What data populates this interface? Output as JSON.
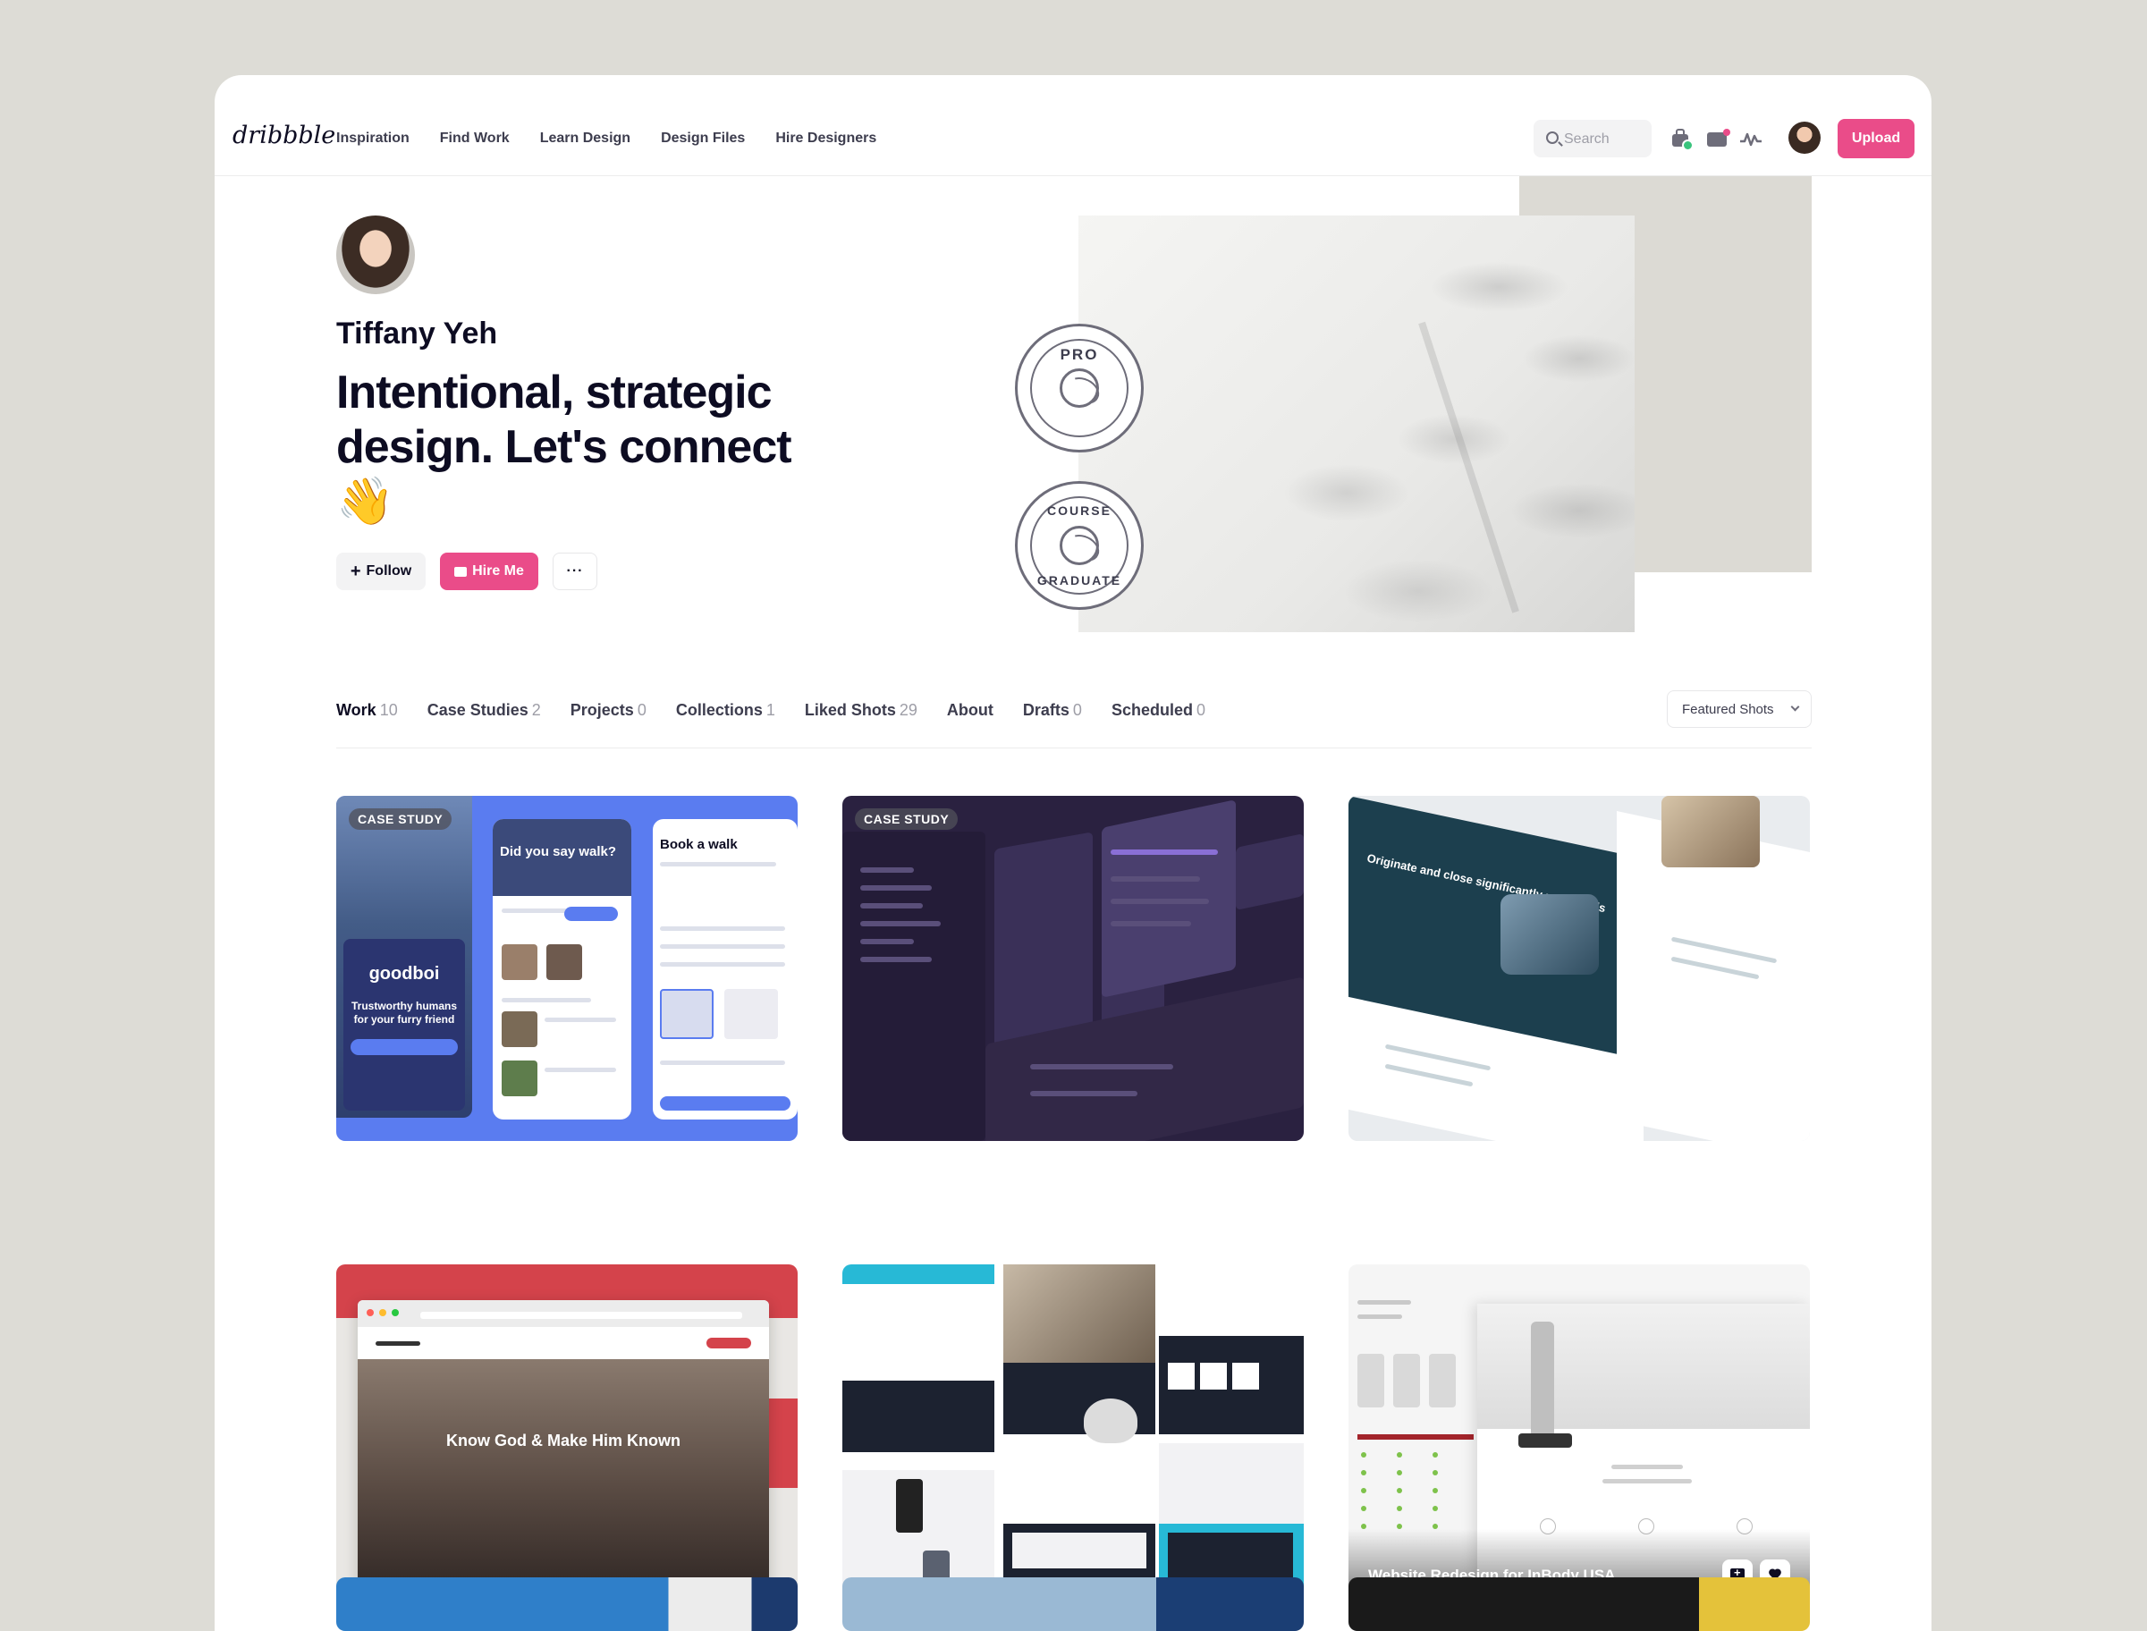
{
  "nav": {
    "logo": "dribbble",
    "links": [
      "Inspiration",
      "Find Work",
      "Learn Design",
      "Design Files",
      "Hire Designers"
    ],
    "search_placeholder": "Search",
    "upload_label": "Upload",
    "icons": [
      "search-icon",
      "briefcase-icon",
      "mail-icon",
      "activity-icon",
      "avatar"
    ]
  },
  "profile": {
    "name": "Tiffany Yeh",
    "headline": "Intentional, strategic design. Let's connect 👋",
    "follow_label": "Follow",
    "hire_label": "Hire Me",
    "more_label": "···",
    "badges": [
      {
        "top": "PRO"
      },
      {
        "top": "COURSE",
        "bottom": "GRADUATE"
      }
    ]
  },
  "tabs": [
    {
      "label": "Work",
      "count": "10"
    },
    {
      "label": "Case Studies",
      "count": "2"
    },
    {
      "label": "Projects",
      "count": "0"
    },
    {
      "label": "Collections",
      "count": "1"
    },
    {
      "label": "Liked Shots",
      "count": "29"
    },
    {
      "label": "About",
      "count": ""
    },
    {
      "label": "Drafts",
      "count": "0"
    },
    {
      "label": "Scheduled",
      "count": "0"
    }
  ],
  "sort": {
    "selected": "Featured Shots"
  },
  "shots": {
    "s1": {
      "badge": "CASE STUDY",
      "brand": "goodboi",
      "tagline": "Trustworthy humans for your furry friend",
      "phone1_title": "Did you say walk?",
      "phone2_title": "Book a walk"
    },
    "s2": {
      "badge": "CASE STUDY"
    },
    "s3": {
      "headline": "Originate and close significantly more deals"
    },
    "s4": {
      "hero": "Know God & Make Him Known"
    },
    "s6": {
      "title": "Website Redesign for InBody USA"
    }
  },
  "colors": {
    "accent": "#ea4c89",
    "background": "#dddcd6",
    "text": "#0d0c22"
  }
}
